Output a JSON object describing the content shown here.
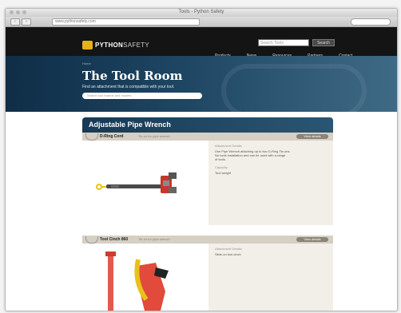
{
  "browser": {
    "window_title": "Tools - Python Safety",
    "url": "www.pythonsafety.com",
    "back": "‹",
    "forward": "›"
  },
  "header": {
    "logo_main": "PYTHON",
    "logo_sub": "SAFETY",
    "search_placeholder": "Search Tools",
    "search_button": "Search",
    "nav": [
      "Products",
      "News",
      "Resources",
      "Partners",
      "Contact"
    ]
  },
  "hero": {
    "breadcrumb": "Home",
    "title": "The Tool Room",
    "subtitle": "Find an attachment that is compatible with your tool.",
    "search_placeholder": "Search tool brands and models"
  },
  "category": {
    "title": "Adjustable Pipe Wrench"
  },
  "products": [
    {
      "name": "D-Ring Cord",
      "subtitle": "Tie-on for pipe wrench",
      "button": "View details",
      "desc_label": "Attachment Details",
      "desc_lines": [
        "Use Pipe Wrench attaching up to two D-Ring Tie-ons.",
        "No tools installation and can be used with a range",
        "of tools."
      ],
      "desc_label2": "Capacity",
      "desc_line2": "Tool weight"
    },
    {
      "name": "Tool Cinch 860",
      "subtitle": "Tie-on for pipe wrench",
      "button": "View details",
      "desc_label": "Attachment Details",
      "desc_lines": [
        "Slide-on tool cinch"
      ],
      "desc_label2": "",
      "desc_line2": ""
    }
  ],
  "colors": {
    "header_bg": "#141414",
    "hero_bg": "#1e4663",
    "logo_accent": "#e8b21c",
    "category_bar": "#173a55",
    "product_bar": "#d6cfc3",
    "tool_red": "#d23a2e",
    "tether_yellow": "#e8c21c"
  }
}
